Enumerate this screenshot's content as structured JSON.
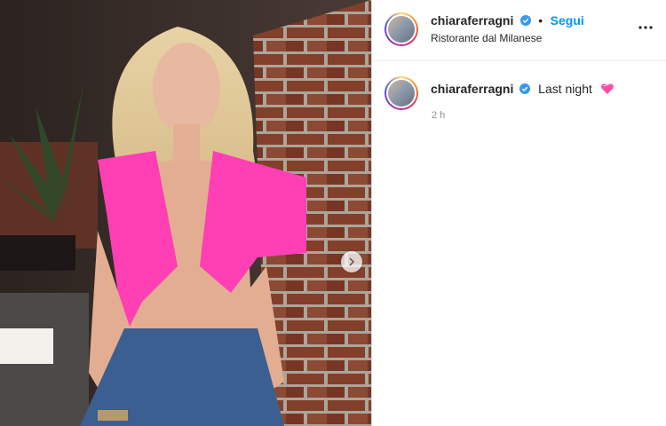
{
  "post": {
    "username": "chiaraferragni",
    "follow_label": "Segui",
    "location": "Ristorante dal Milanese",
    "caption": "Last night",
    "caption_emoji": "sparkling-heart-icon",
    "time": "2 h"
  },
  "colors": {
    "accent": "#0095f6",
    "text": "#262626",
    "muted": "#8e8e8e",
    "heart": "#ff4da6"
  }
}
